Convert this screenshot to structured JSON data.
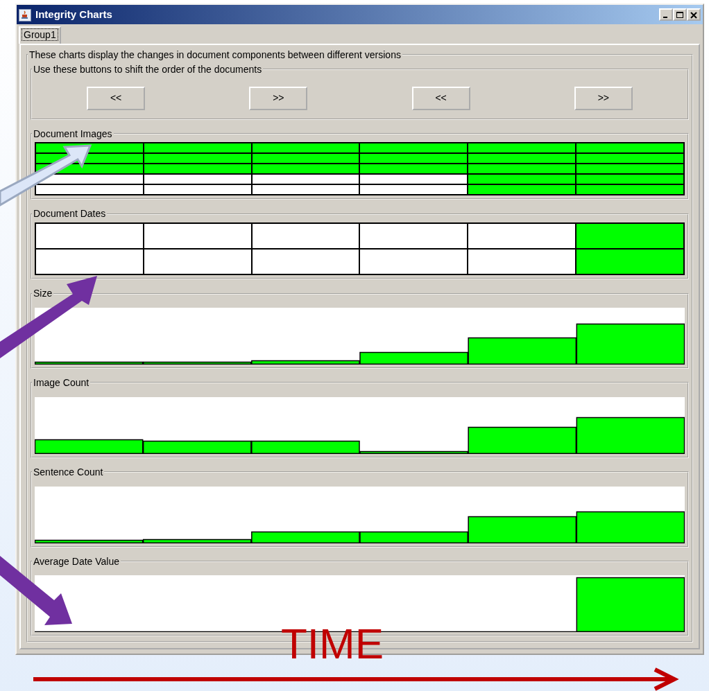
{
  "window": {
    "title": "Integrity Charts"
  },
  "tabs": [
    {
      "label": "Group1",
      "selected": true
    }
  ],
  "panel": {
    "legend": "These charts display the changes in document components between different versions",
    "buttons_group": {
      "legend": "Use these buttons to shift the order of the documents",
      "buttons": [
        "<<",
        ">>",
        "<<",
        ">>"
      ]
    },
    "charts": [
      {
        "kind": "grid",
        "title": "Document Images",
        "rows": [
          {
            "filled": [
              true,
              true,
              true,
              true,
              true,
              true
            ]
          },
          {
            "filled": [
              true,
              true,
              true,
              true,
              true,
              true
            ]
          },
          {
            "filled": [
              true,
              true,
              true,
              true,
              true,
              true
            ]
          },
          {
            "filled": [
              false,
              false,
              false,
              false,
              true,
              true
            ]
          },
          {
            "filled": [
              false,
              false,
              false,
              false,
              true,
              true
            ]
          }
        ]
      },
      {
        "kind": "grid",
        "title": "Document Dates",
        "rows": [
          {
            "filled": [
              false,
              false,
              false,
              false,
              false,
              true
            ]
          },
          {
            "filled": [
              false,
              false,
              false,
              false,
              false,
              true
            ]
          }
        ]
      },
      {
        "kind": "bars",
        "title": "Size"
      },
      {
        "kind": "bars",
        "title": "Image Count"
      },
      {
        "kind": "bars",
        "title": "Sentence Count"
      },
      {
        "kind": "bars",
        "title": "Average Date Value"
      }
    ]
  },
  "annotation": {
    "label": "TIME"
  }
}
